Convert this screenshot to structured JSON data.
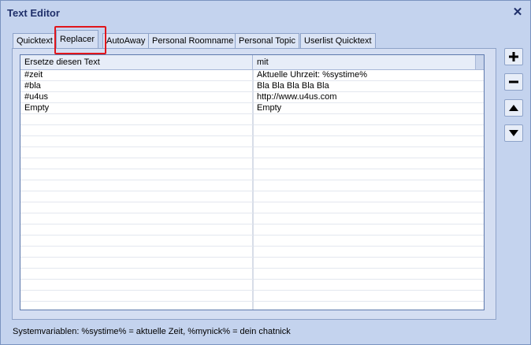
{
  "window": {
    "title": "Text Editor"
  },
  "tabs": [
    {
      "label": "Quicktext",
      "active": false
    },
    {
      "label": "Replacer",
      "active": true
    },
    {
      "label": "AutoAway",
      "active": false
    },
    {
      "label": "Personal Roomname",
      "active": false
    },
    {
      "label": "Personal Topic",
      "active": false
    },
    {
      "label": "Userlist Quicktext",
      "active": false
    }
  ],
  "table": {
    "columns": [
      "Ersetze diesen Text",
      "mit"
    ],
    "rows": [
      [
        "#zeit",
        "Aktuelle Uhrzeit: %systime%"
      ],
      [
        "#bla",
        "Bla Bla Bla Bla Bla"
      ],
      [
        "#u4us",
        "http://www.u4us.com"
      ],
      [
        "Empty",
        "Empty"
      ],
      [
        "",
        ""
      ],
      [
        "",
        ""
      ],
      [
        "",
        ""
      ],
      [
        "",
        ""
      ],
      [
        "",
        ""
      ],
      [
        "",
        ""
      ],
      [
        "",
        ""
      ],
      [
        "",
        ""
      ],
      [
        "",
        ""
      ],
      [
        "",
        ""
      ],
      [
        "",
        ""
      ],
      [
        "",
        ""
      ],
      [
        "",
        ""
      ],
      [
        "",
        ""
      ],
      [
        "",
        ""
      ],
      [
        "",
        ""
      ],
      [
        "",
        ""
      ],
      [
        "",
        ""
      ]
    ]
  },
  "side_buttons": [
    {
      "name": "add-button",
      "icon": "plus-icon"
    },
    {
      "name": "remove-button",
      "icon": "minus-icon"
    },
    {
      "name": "move-up-button",
      "icon": "arrow-up-icon"
    },
    {
      "name": "move-down-button",
      "icon": "arrow-down-icon"
    }
  ],
  "status": {
    "text": "Systemvariablen: %systime% = aktuelle Zeit, %mynick% = dein chatnick"
  },
  "colors": {
    "accent": "#1f2f6a",
    "highlight": "#e0151b",
    "window_bg": "#c4d3ee"
  }
}
